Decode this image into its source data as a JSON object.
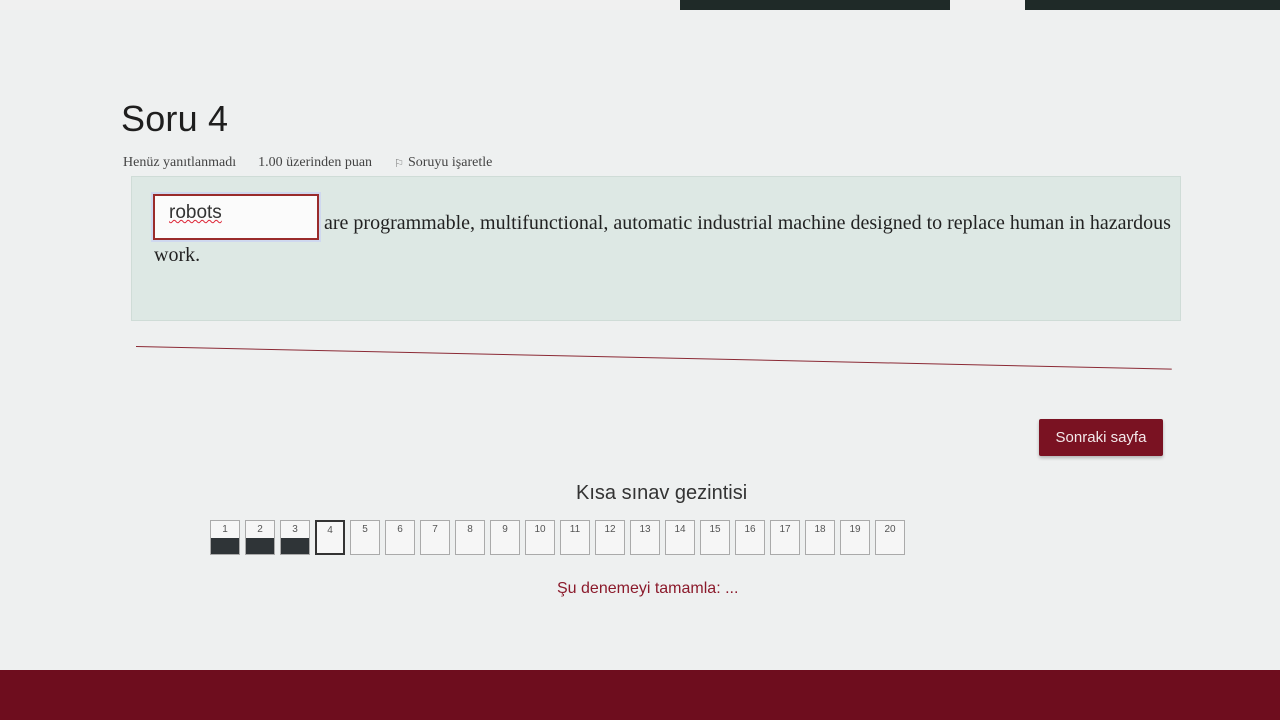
{
  "question": {
    "title": "Soru 4",
    "status": "Henüz yanıtlanmadı",
    "points": "1.00 üzerinden puan",
    "flag_label": "Soruyu işaretle",
    "flag_icon": "flag-icon",
    "answer_value": "robots",
    "text": "are programmable, multifunctional, automatic industrial machine designed to replace human in hazardous work."
  },
  "navigation": {
    "next_button": "Sonraki sayfa",
    "title": "Kısa sınav gezintisi",
    "items": [
      {
        "label": "1",
        "state": "answered"
      },
      {
        "label": "2",
        "state": "answered"
      },
      {
        "label": "3",
        "state": "answered"
      },
      {
        "label": "4",
        "state": "current"
      },
      {
        "label": "5",
        "state": "unanswered"
      },
      {
        "label": "6",
        "state": "unanswered"
      },
      {
        "label": "7",
        "state": "unanswered"
      },
      {
        "label": "8",
        "state": "unanswered"
      },
      {
        "label": "9",
        "state": "unanswered"
      },
      {
        "label": "10",
        "state": "unanswered"
      },
      {
        "label": "11",
        "state": "unanswered"
      },
      {
        "label": "12",
        "state": "unanswered"
      },
      {
        "label": "13",
        "state": "unanswered"
      },
      {
        "label": "14",
        "state": "unanswered"
      },
      {
        "label": "15",
        "state": "unanswered"
      },
      {
        "label": "16",
        "state": "unanswered"
      },
      {
        "label": "17",
        "state": "unanswered"
      },
      {
        "label": "18",
        "state": "unanswered"
      },
      {
        "label": "19",
        "state": "unanswered"
      },
      {
        "label": "20",
        "state": "unanswered"
      }
    ],
    "finish_link": "Şu denemeyi tamamla: ..."
  },
  "colors": {
    "accent": "#7a1222",
    "question_box": "#dde8e4"
  }
}
